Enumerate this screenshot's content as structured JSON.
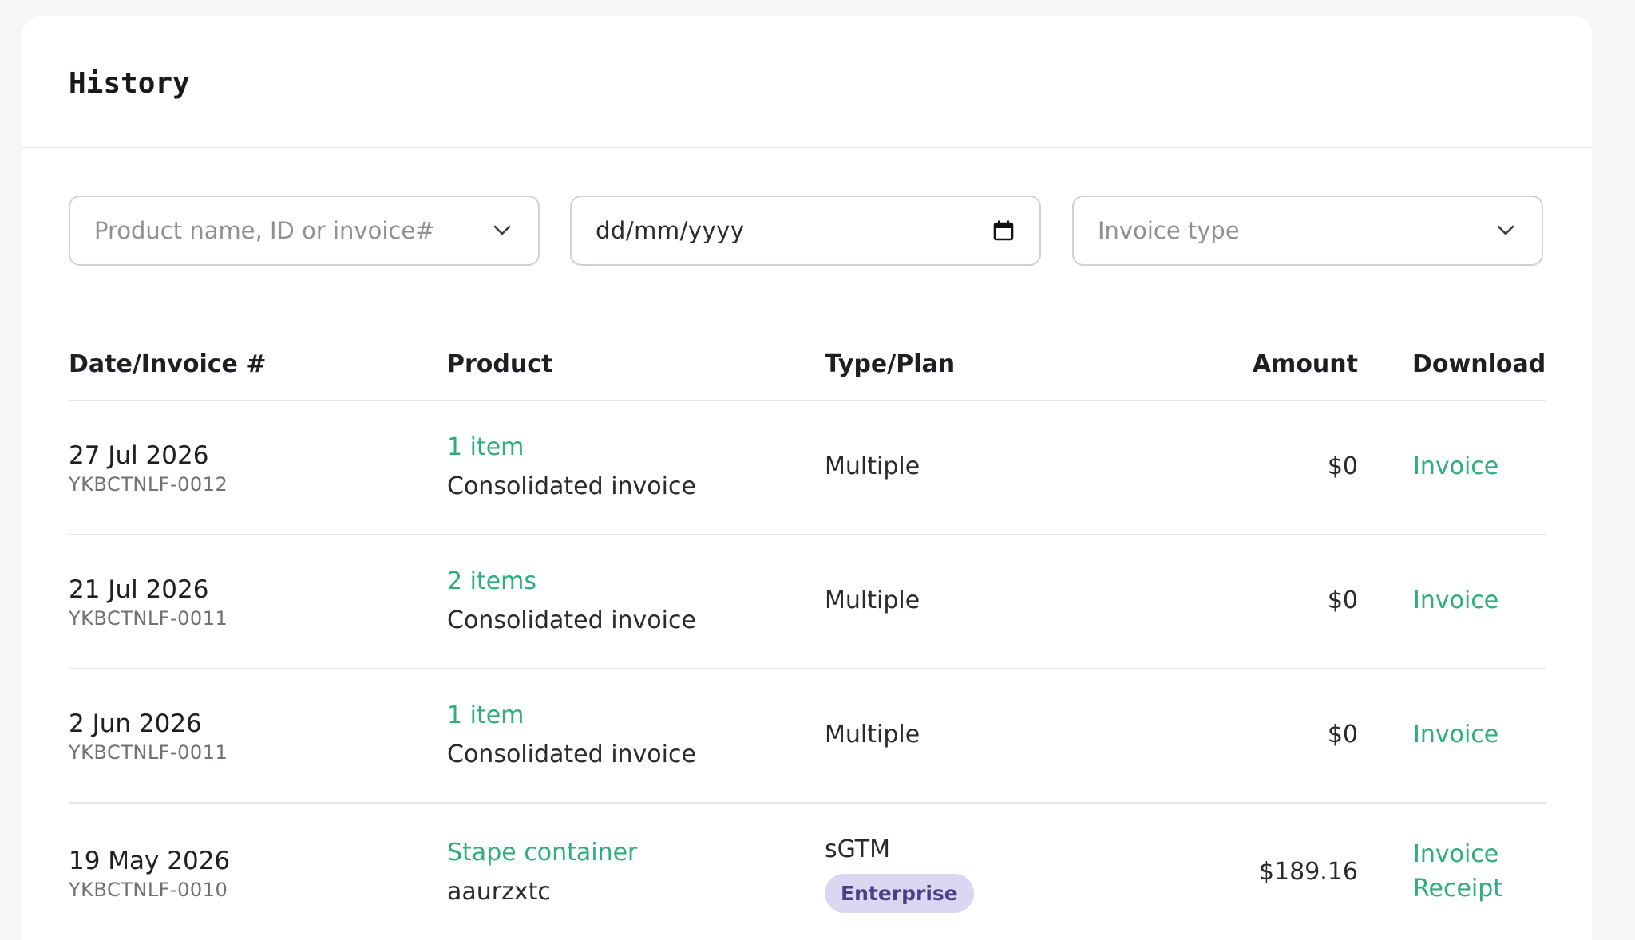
{
  "page": {
    "title": "History"
  },
  "filters": {
    "product": {
      "placeholder": "Product name, ID or invoice#"
    },
    "date": {
      "value": "dd/mm/yyyy"
    },
    "invoice_type": {
      "placeholder": "Invoice type"
    }
  },
  "table": {
    "columns": {
      "date": "Date/Invoice #",
      "product": "Product",
      "type": "Type/Plan",
      "amount": "Amount",
      "download": "Download"
    },
    "rows": [
      {
        "date": "27 Jul 2026",
        "invoice": "YKBCTNLF-0012",
        "product_link": "1 item",
        "product_sub": "Consolidated invoice",
        "type": "Multiple",
        "amount": "$0",
        "download": "Invoice"
      },
      {
        "date": "21 Jul 2026",
        "invoice": "YKBCTNLF-0011",
        "product_link": "2 items",
        "product_sub": "Consolidated invoice",
        "type": "Multiple",
        "amount": "$0",
        "download": "Invoice"
      },
      {
        "date": "2 Jun 2026",
        "invoice": "YKBCTNLF-0011",
        "product_link": "1 item",
        "product_sub": "Consolidated invoice",
        "type": "Multiple",
        "amount": "$0",
        "download": "Invoice"
      },
      {
        "date": "19 May 2026",
        "invoice": "YKBCTNLF-0010",
        "product_link": "Stape container",
        "product_sub": "aaurzxtc",
        "type": "sGTM",
        "plan": "Enterprise",
        "amount": "$189.16",
        "download": "Invoice",
        "download2": "Receipt"
      }
    ]
  },
  "colors": {
    "accent": "#2eae7e",
    "badge_bg": "#dcd6f2",
    "badge_text": "#4a3f86"
  }
}
